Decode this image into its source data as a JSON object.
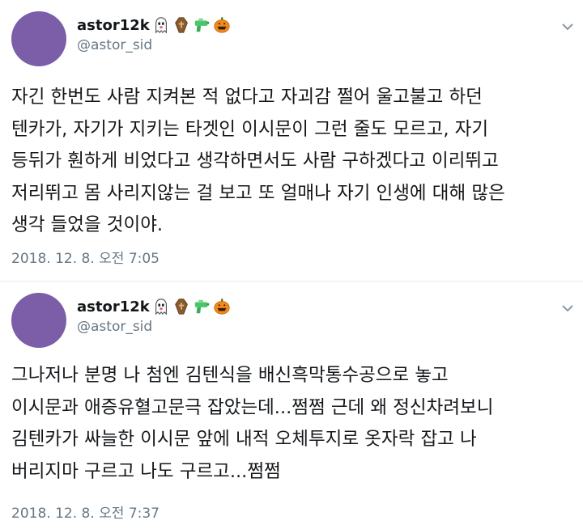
{
  "tweets": [
    {
      "user": {
        "display_name": "astor12k",
        "handle": "@astor_sid",
        "avatar_color": "#7b5ea7"
      },
      "emoji_icons": [
        "ghost-icon",
        "coffin-icon",
        "water-pistol-icon",
        "jack-o-lantern-icon"
      ],
      "text": "자긴 한번도 사람 지켜본 적 없다고 자괴감 쩔어 울고불고 하던\n텐카가, 자기가 지키는 타겟인 이시문이 그런 줄도 모르고, 자기\n등뒤가 훤하게 비었다고 생각하면서도 사람 구하겠다고 이리뛰고\n저리뛰고 몸 사리지않는 걸 보고 또 얼매나 자기 인생에 대해 많은\n생각 들었을 것이야.",
      "timestamp": "2018. 12. 8. 오전 7:05"
    },
    {
      "user": {
        "display_name": "astor12k",
        "handle": "@astor_sid",
        "avatar_color": "#7b5ea7"
      },
      "emoji_icons": [
        "ghost-icon",
        "coffin-icon",
        "water-pistol-icon",
        "jack-o-lantern-icon"
      ],
      "text": "그나저나 분명 나 첨엔 김텐식을 배신흑막통수공으로 놓고\n이시문과 애증유혈고문극 잡았는데...쩜쩜 근데 왜 정신차려보니\n김텐카가 싸늘한 이시문 앞에 내적 오체투지로 옷자락 잡고 나\n버리지마 구르고 나도 구르고...쩜쩜",
      "timestamp": "2018. 12. 8. 오전 7:37"
    }
  ]
}
